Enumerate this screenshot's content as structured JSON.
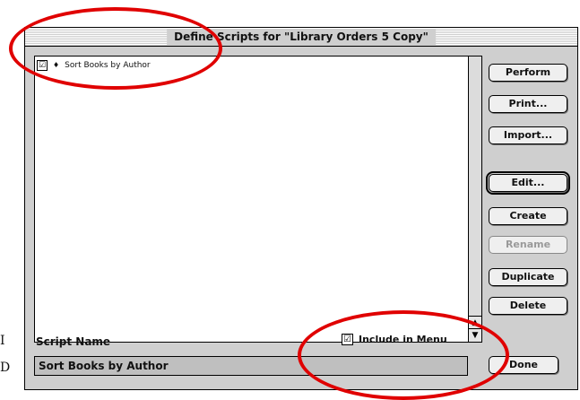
{
  "window": {
    "title": "Define Scripts for \"Library Orders 5 Copy\""
  },
  "scripts": [
    {
      "checked": true,
      "marker": "♦",
      "name": "Sort Books by Author"
    }
  ],
  "buttons": {
    "perform": "Perform",
    "print": "Print...",
    "import": "Import...",
    "edit": "Edit...",
    "create": "Create",
    "rename": "Rename",
    "duplicate": "Duplicate",
    "delete": "Delete",
    "done": "Done"
  },
  "script_name": {
    "label": "Script Name",
    "value": "Sort Books by Author"
  },
  "include_in_menu": {
    "checked": true,
    "label": "Include in Menu"
  },
  "margin_text": {
    "line1": "I",
    "line2": "D"
  },
  "colors": {
    "annotation": "#e00000",
    "window_bg": "#cfcfcf"
  }
}
